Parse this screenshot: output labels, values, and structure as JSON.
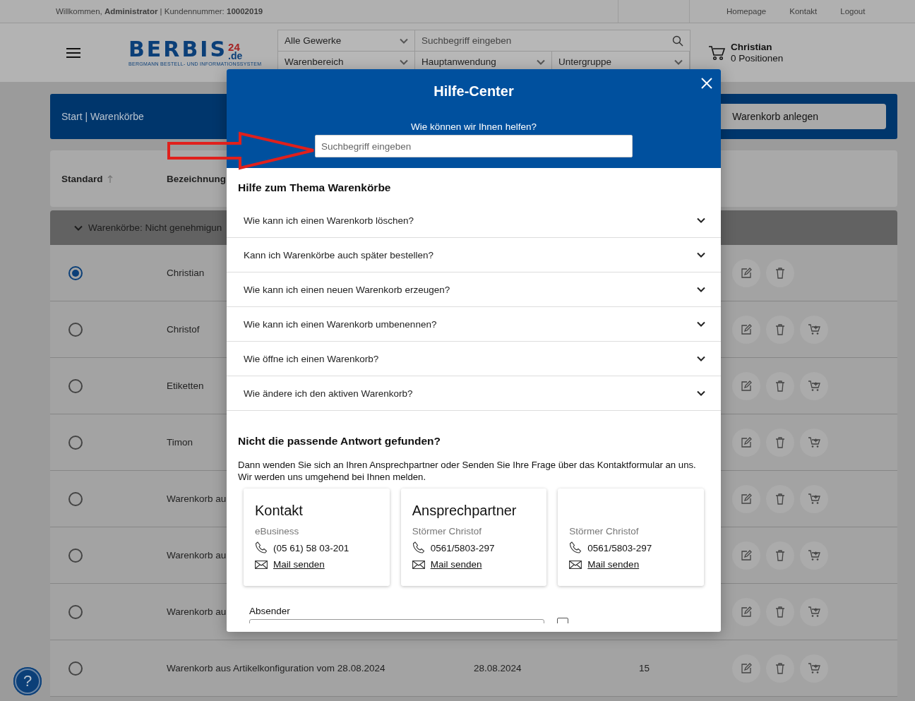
{
  "top_bar": {
    "welcome": "Willkommen, **Administrator** | Kundennummer: **10002019**",
    "links": [
      "Homepage",
      "Kontakt",
      "Logout"
    ]
  },
  "header": {
    "logo": {
      "name": "BERBIS",
      "badge": "24",
      "suffix": ".de",
      "tagline": "BERGMANN BESTELL- UND INFORMATIONSSYSTEM"
    },
    "search": {
      "trade": "Alle Gewerke",
      "placeholder": "Suchbegriff eingeben",
      "filters": [
        "Warenbereich",
        "Hauptanwendung",
        "Untergruppe"
      ]
    },
    "cart": {
      "user": "Christian",
      "positions": "0 Positionen"
    }
  },
  "breadcrumb": "Start | Warenkörbe",
  "new_cart_button": "Warenkorb anlegen",
  "table": {
    "columns": [
      {
        "label": "Standard",
        "sorted": true
      },
      {
        "label": "Bezeichnung"
      }
    ],
    "group": {
      "label": "Warenkörbe: Nicht genehmigun",
      "expanded": true
    },
    "rows": [
      {
        "selected": true,
        "name": "Christian",
        "cart_action": false
      },
      {
        "selected": false,
        "name": "Christof",
        "cart_action": true
      },
      {
        "selected": false,
        "name": "Etiketten",
        "cart_action": true
      },
      {
        "selected": false,
        "name": "Timon",
        "cart_action": true
      },
      {
        "selected": false,
        "name": "Warenkorb au",
        "cart_action": true
      },
      {
        "selected": false,
        "name": "Warenkorb au",
        "cart_action": true
      },
      {
        "selected": false,
        "name": "Warenkorb au",
        "cart_action": true
      },
      {
        "selected": false,
        "name": "Warenkorb aus Artikelkonfiguration vom 28.08.2024",
        "column_3": "28.08.2024",
        "column_4": "15",
        "cart_action": true
      }
    ]
  },
  "help_button": "?",
  "modal": {
    "title": "Hilfe-Center",
    "prompt": "Wie können wir Ihnen helfen?",
    "search_placeholder": "Suchbegriff eingeben",
    "topic_heading": "Hilfe zum Thema Warenkörbe",
    "faq": [
      {
        "question": "Wie kann ich einen Warenkorb löschen?",
        "expanded": false
      },
      {
        "question": "Kann ich Warenkörbe auch später bestellen?",
        "expanded": false
      },
      {
        "question": "Wie kann ich einen neuen Warenkorb erzeugen?",
        "expanded": false
      },
      {
        "question": "Wie kann ich einen Warenkorb umbenennen?",
        "expanded": false
      },
      {
        "question": "Wie öffne ich einen Warenkorb?",
        "expanded": false
      },
      {
        "question": "Wie ändere ich den aktiven Warenkorb?",
        "expanded": false
      }
    ],
    "contact_heading": "Nicht die passende Antwort gefunden?",
    "contact_text": "Dann wenden Sie sich an Ihren Ansprechpartner oder Senden Sie Ihre Frage über das Kontaktformular an uns. Wir werden uns umgehend bei Ihnen melden.",
    "cards": [
      {
        "title": "Kontakt",
        "subtitle": "eBusiness",
        "phone": "(05 61) 58 03-201",
        "link": "Mail senden"
      },
      {
        "title": "Ansprechpartner",
        "subtitle": "Störmer Christof",
        "phone": "0561/5803-297",
        "link": "Mail senden"
      },
      {
        "subtitle": "Störmer Christof",
        "phone": "0561/5803-297",
        "link": "Mail senden"
      }
    ],
    "form": {
      "sender_label": "Absender",
      "copy_checkbox": {
        "checked": false
      }
    }
  }
}
